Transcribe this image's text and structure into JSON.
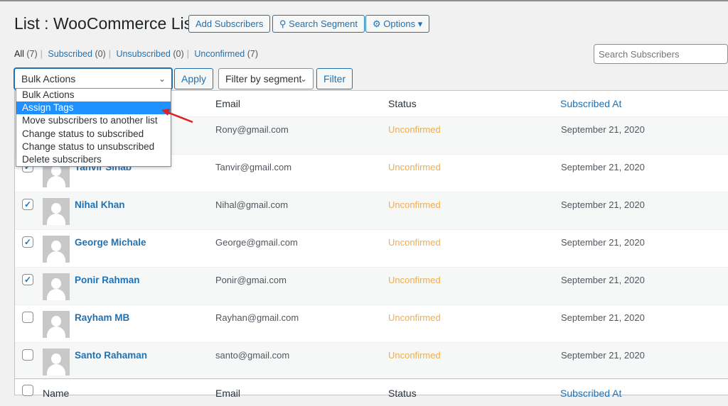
{
  "title": "List : WooCommerce List",
  "toolbar": {
    "add_subscribers": "Add Subscribers",
    "search_segment": "Search Segment",
    "options": "Options"
  },
  "views": [
    {
      "label": "All",
      "count": "(7)"
    },
    {
      "label": "Subscribed",
      "count": "(0)"
    },
    {
      "label": "Unsubscribed",
      "count": "(0)"
    },
    {
      "label": "Unconfirmed",
      "count": "(7)"
    }
  ],
  "search": {
    "placeholder": "Search Subscribers"
  },
  "bulk": {
    "selected": "Bulk Actions",
    "apply": "Apply",
    "options": [
      "Bulk Actions",
      "Assign Tags",
      "Move subscribers to another list",
      "Change status to subscribed",
      "Change status to unsubscribed",
      "Delete subscribers"
    ],
    "highlighted": "Assign Tags"
  },
  "segment": {
    "selected": "Filter by segment",
    "filter": "Filter"
  },
  "columns": {
    "name": "Name",
    "email": "Email",
    "status": "Status",
    "subscribed_at": "Subscribed At"
  },
  "rows": [
    {
      "name": "",
      "email": "Rony@gmail.com",
      "status": "Unconfirmed",
      "date": "September 21, 2020",
      "checked": true
    },
    {
      "name": "Tanvir Sinab",
      "email": "Tanvir@gmail.com",
      "status": "Unconfirmed",
      "date": "September 21, 2020",
      "checked": true
    },
    {
      "name": "Nihal Khan",
      "email": "Nihal@gmail.com",
      "status": "Unconfirmed",
      "date": "September 21, 2020",
      "checked": true
    },
    {
      "name": "George Michale",
      "email": "George@gmail.com",
      "status": "Unconfirmed",
      "date": "September 21, 2020",
      "checked": true
    },
    {
      "name": "Ponir Rahman",
      "email": "Ponir@gmai.com",
      "status": "Unconfirmed",
      "date": "September 21, 2020",
      "checked": true
    },
    {
      "name": "Rayham MB",
      "email": "Rayhan@gmail.com",
      "status": "Unconfirmed",
      "date": "September 21, 2020",
      "checked": false
    },
    {
      "name": "Santo Rahaman",
      "email": "santo@gmail.com",
      "status": "Unconfirmed",
      "date": "September 21, 2020",
      "checked": false
    }
  ],
  "colors": {
    "accent": "#2271b1",
    "status_unconfirmed": "#f0ad4e",
    "highlight": "#1e90ff",
    "arrow": "#e02020"
  }
}
